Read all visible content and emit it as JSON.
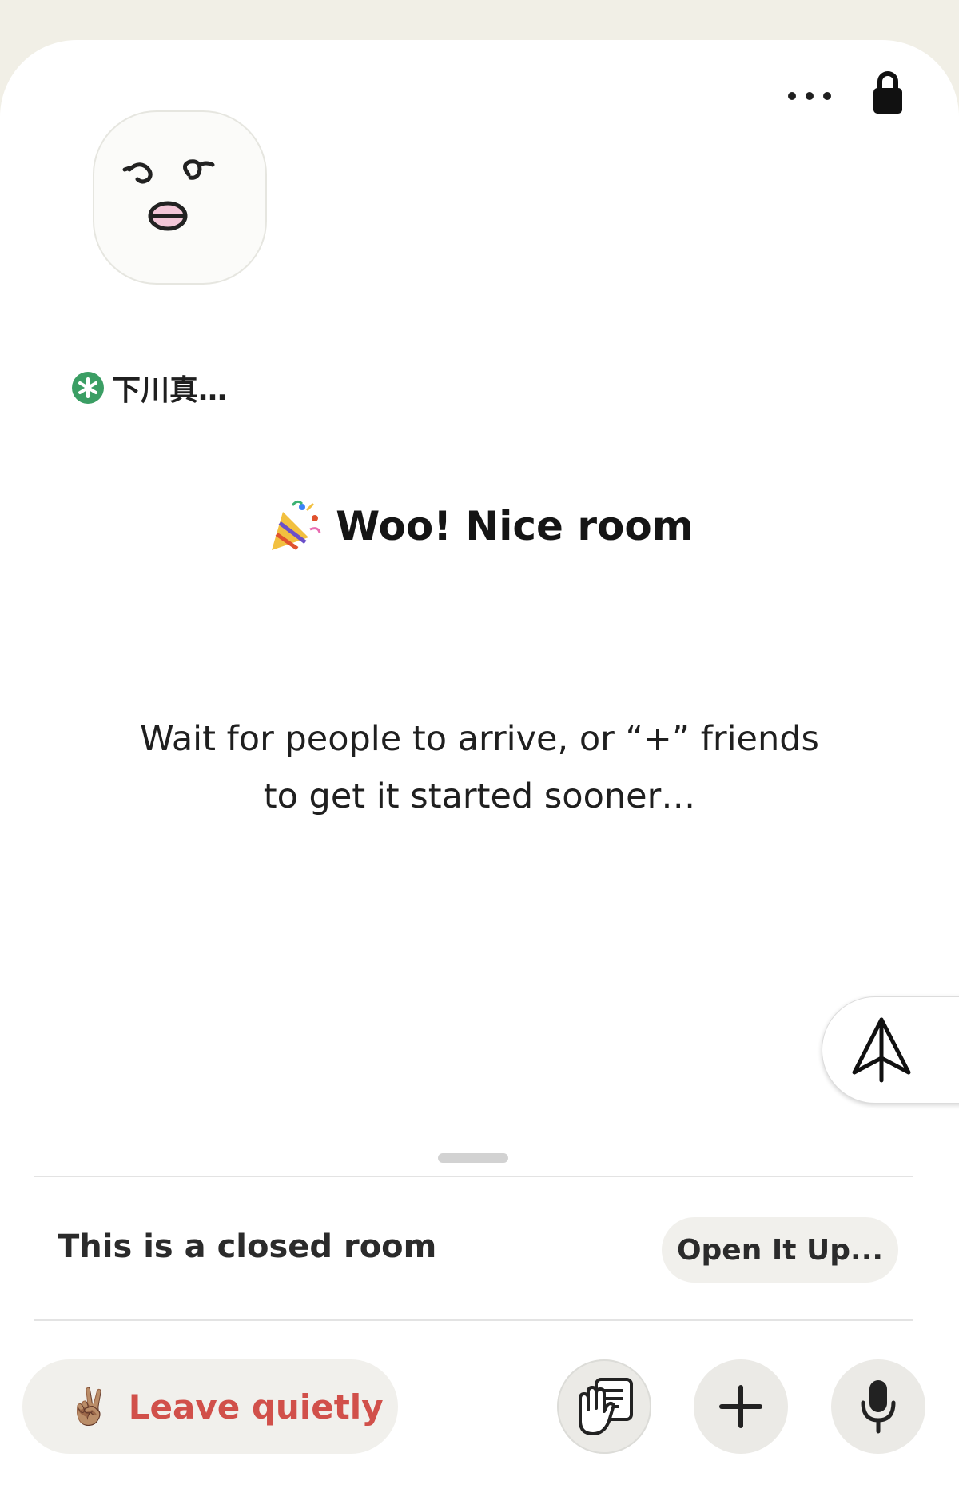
{
  "room": {
    "speaker_name": "下川真…",
    "welcome_title": "Woo! Nice room",
    "subtitle_line1": "Wait for people to arrive, or “+” friends",
    "subtitle_line2": "to get it started sooner…"
  },
  "privacy": {
    "closed_label": "This is a closed room",
    "open_button_label": "Open It Up..."
  },
  "bottom_bar": {
    "leave_label": "Leave quietly",
    "leave_emoji": "✌🏽"
  },
  "colors": {
    "background": "#f1efe6",
    "sheet": "#ffffff",
    "badge_green": "#3b9e64",
    "leave_red": "#d1504a",
    "button_gray": "#f1f0ec"
  },
  "icons": [
    "more-icon",
    "lock-icon",
    "party-popper-icon",
    "share-arrow-icon",
    "raise-hand-icon",
    "plus-icon",
    "mic-icon"
  ]
}
